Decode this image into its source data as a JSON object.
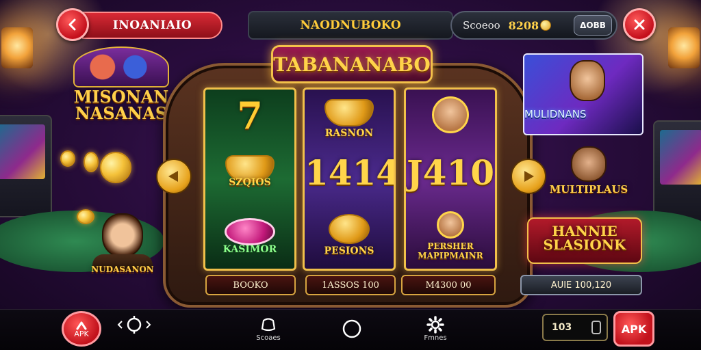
{
  "header": {
    "title": "INOANIAIO",
    "center_title": "NAODNUBOKO",
    "score_label": "Scoeoo",
    "score_value": "8208",
    "score_badge": "ΔOBB"
  },
  "machine": {
    "marquee": "TABANANABO",
    "reels": [
      {
        "symbols": [
          "7",
          "SZQIOS",
          "KASIMOR"
        ]
      },
      {
        "symbols": [
          "RASNON",
          "1414",
          "PESIONS"
        ]
      },
      {
        "symbols": [
          "",
          "J410",
          "PERSHER MAPIPMAINR"
        ]
      }
    ],
    "payouts": [
      "BOOKO",
      "1ASSOS 100",
      "M4300 00",
      "AUIE 100,120"
    ]
  },
  "promos": {
    "left_banner": "MISONAN NASANAS",
    "right_card": "MULIDNANS",
    "multiplayer": "MULTIPLAUS",
    "haunt": "HANNIE SLASIONK",
    "left_person": "NUDASANON"
  },
  "bottom_nav": {
    "apk_left": "APK",
    "games_label": "Scoaes",
    "settings_label": "Fmnes",
    "counter_value": "103",
    "apk_right": "APK"
  },
  "colors": {
    "accent_gold": "#ffd34a",
    "button_red": "#c40f1c",
    "background": "#2a0d3e"
  },
  "icons": {
    "back": "chevron-left-icon",
    "close": "close-icon",
    "audio": "audio-icon",
    "games": "games-icon",
    "home": "home-icon",
    "settings": "gear-icon",
    "share": "share-icon"
  }
}
